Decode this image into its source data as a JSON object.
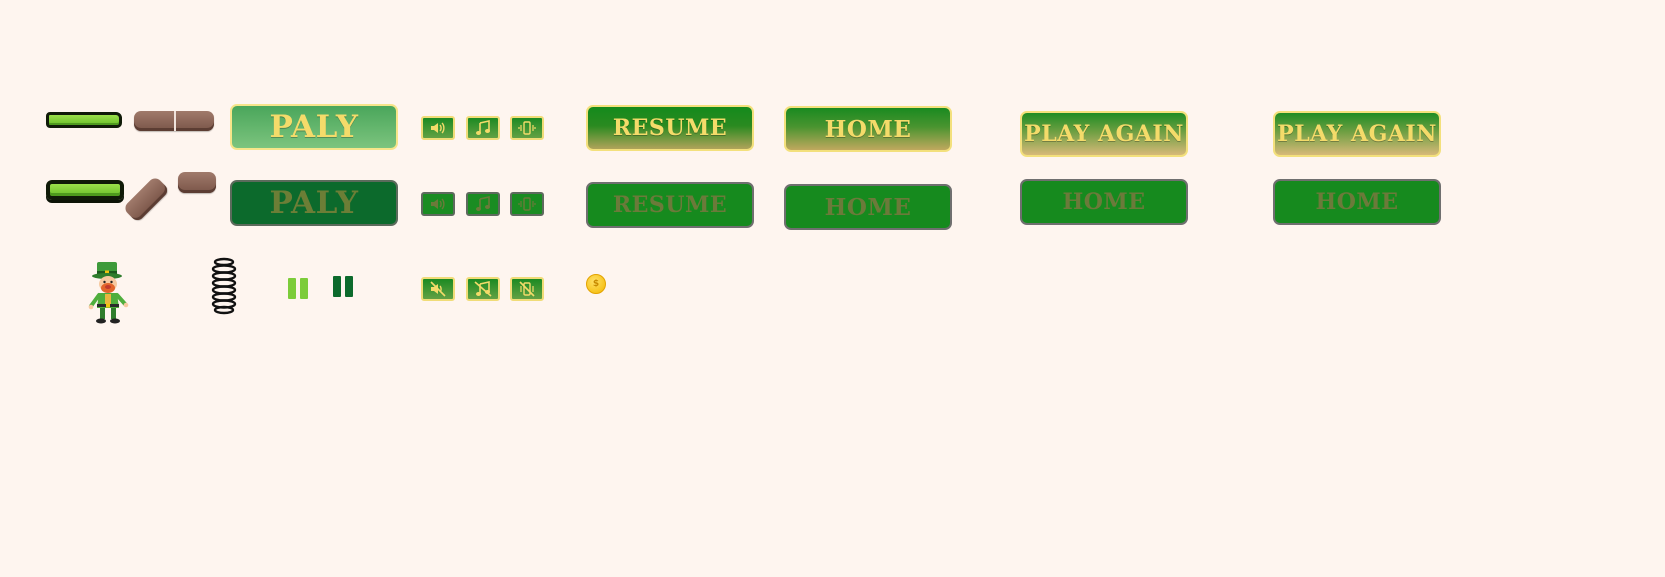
{
  "buttons": {
    "play_label": "PALY",
    "resume_label": "RESUME",
    "home_label": "HOME",
    "play_again_label": "PLAY AGAIN"
  },
  "icons": {
    "sound": "speaker-icon",
    "music": "music-note-icon",
    "vibration": "vibration-icon",
    "sound_off": "speaker-muted-icon",
    "music_off": "music-muted-icon",
    "vibration_off": "vibration-off-icon",
    "pause": "pause-icon",
    "spring": "spring-icon",
    "coin": "coin-icon",
    "character": "leprechaun-character"
  },
  "coin_symbol": "$",
  "colors": {
    "background": "#fef5ef",
    "button_green": "#168a1e",
    "button_gold_border": "#f3e07c",
    "label_gold": "#f4db6a",
    "grass": "#9be04a",
    "wood": "#a07a6b",
    "pause_light": "#7ccc3a",
    "pause_dark": "#0c6a2c",
    "coin": "#f3b800"
  }
}
